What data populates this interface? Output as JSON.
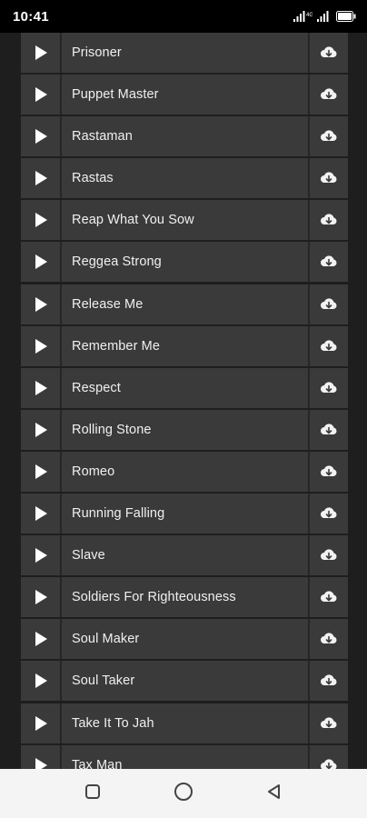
{
  "status_bar": {
    "time": "10:41",
    "icons": [
      "signal-icon",
      "signal-icon",
      "battery-icon"
    ]
  },
  "songs": [
    {
      "title": "Prisoner"
    },
    {
      "title": "Puppet Master"
    },
    {
      "title": "Rastaman"
    },
    {
      "title": "Rastas"
    },
    {
      "title": "Reap What You Sow"
    },
    {
      "title": "Reggea Strong"
    },
    {
      "title": "Release Me"
    },
    {
      "title": "Remember Me"
    },
    {
      "title": "Respect"
    },
    {
      "title": "Rolling Stone"
    },
    {
      "title": "Romeo"
    },
    {
      "title": "Running Falling"
    },
    {
      "title": "Slave"
    },
    {
      "title": "Soldiers For Righteousness"
    },
    {
      "title": "Soul Maker"
    },
    {
      "title": "Soul Taker"
    },
    {
      "title": "Take It To Jah"
    },
    {
      "title": "Tax Man"
    }
  ],
  "row_icons": {
    "play": "play-icon",
    "download": "cloud-download-icon"
  },
  "nav_bar": {
    "buttons": [
      "recents-square-icon",
      "home-circle-icon",
      "back-triangle-icon"
    ]
  },
  "colors": {
    "background": "#1e1e1e",
    "row": "#3a3a3a",
    "text": "#f0f0f0",
    "status_bar": "#000000",
    "nav_bar": "#f4f4f4"
  }
}
